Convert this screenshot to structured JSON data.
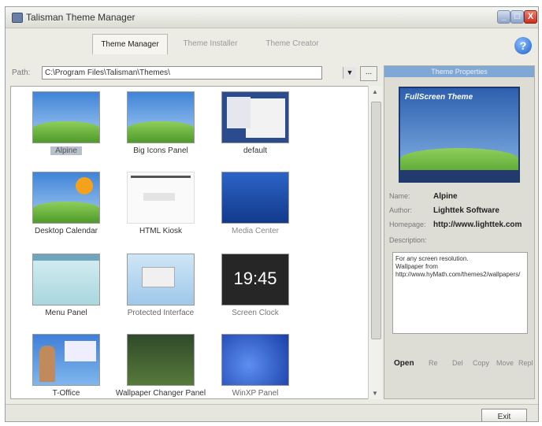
{
  "window": {
    "title": "Talisman Theme Manager",
    "controls": {
      "minimize": "_",
      "maximize": "□",
      "close": "X"
    },
    "help_label": "?"
  },
  "tabs": [
    {
      "label": "Theme Manager",
      "active": true
    },
    {
      "label": "Theme Installer",
      "active": false
    },
    {
      "label": "Theme Creator",
      "active": false
    }
  ],
  "path": {
    "label": "Path:",
    "value": "C:\\Program Files\\Talisman\\Themes\\",
    "dropdown_glyph": "▼",
    "browse_label": "..."
  },
  "themes": [
    {
      "name": "Alpine",
      "selected": true,
      "style": "landscape"
    },
    {
      "name": "Big Icons Panel",
      "selected": false,
      "style": "landscape"
    },
    {
      "name": "default",
      "selected": false,
      "style": "desktop"
    },
    {
      "name": "Desktop Calendar",
      "selected": false,
      "style": "calendar"
    },
    {
      "name": "HTML Kiosk",
      "selected": false,
      "style": "document"
    },
    {
      "name": "Media Center",
      "selected": false,
      "style": "blue"
    },
    {
      "name": "Menu Panel",
      "selected": false,
      "style": "pale"
    },
    {
      "name": "Protected Interface",
      "selected": false,
      "style": "pale"
    },
    {
      "name": "Screen Clock",
      "selected": false,
      "style": "clock",
      "clock_text": "19:45"
    },
    {
      "name": "T-Office",
      "selected": false,
      "style": "office"
    },
    {
      "name": "Wallpaper Changer Panel",
      "selected": false,
      "style": "forest"
    },
    {
      "name": "WinXP Panel",
      "selected": false,
      "style": "blue"
    }
  ],
  "properties": {
    "header": "Theme Properties",
    "preview_title": "FullScreen Theme",
    "fields": [
      {
        "label": "Name:",
        "value": "Alpine"
      },
      {
        "label": "Author:",
        "value": "Lighttek Software"
      },
      {
        "label": "Homepage:",
        "value": "http://www.lighttek.com"
      }
    ],
    "description_label": "Description:",
    "description": "For any screen resolution.\nWallpaper from\nhttp://www.hyMath.com/themes2/wallpapers/",
    "actions": [
      "Open",
      "Re",
      "Del",
      "Copy",
      "Move",
      "Repl"
    ]
  },
  "footer": {
    "exit_label": "Exit"
  },
  "colors": {
    "accent": "#1b5fc9",
    "close": "#c9301c",
    "selection": "#b8c0cc"
  }
}
